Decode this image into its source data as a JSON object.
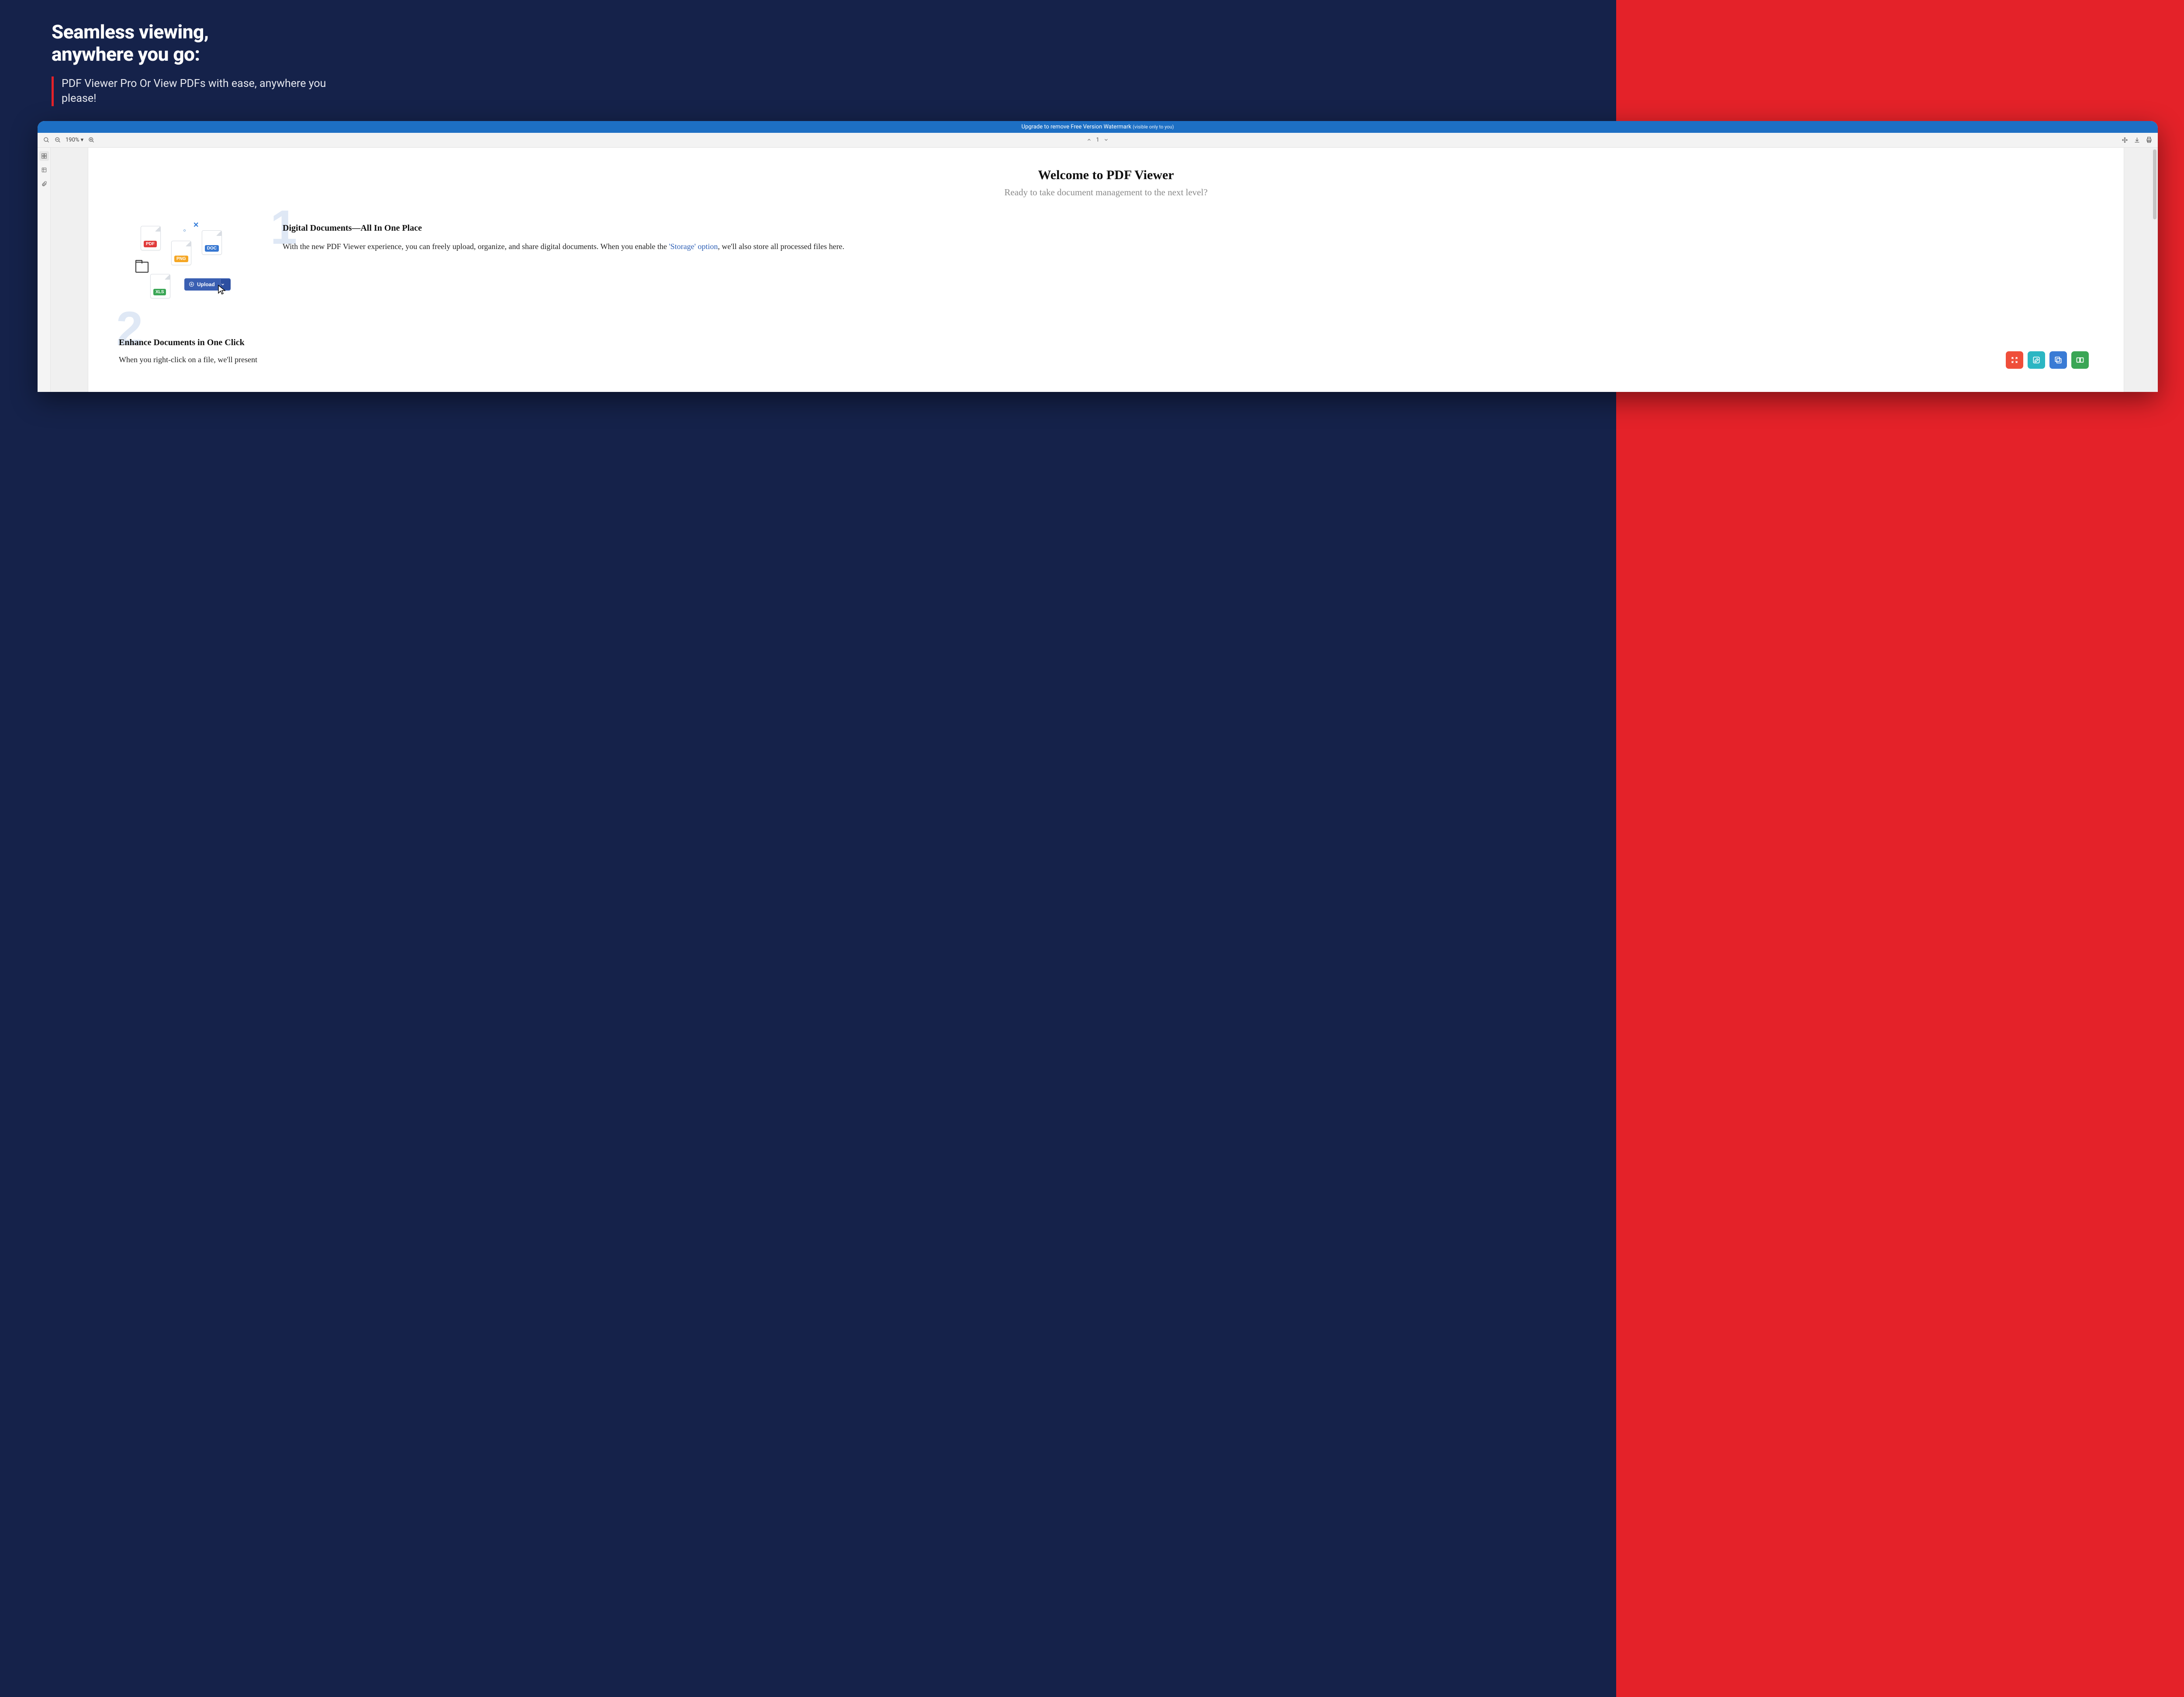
{
  "hero": {
    "title_l1": "Seamless viewing,",
    "title_l2": "anywhere you go:",
    "subtitle": "PDF Viewer Pro Or View PDFs with ease, anywhere you please!"
  },
  "banner": {
    "main": "Upgrade to remove Free Version Watermark ",
    "small": "(visible only to you)"
  },
  "toolbar": {
    "zoom": "190% ▾",
    "page": "1"
  },
  "document": {
    "title": "Welcome to PDF Viewer",
    "subtitle": "Ready to take document management to the next level?",
    "badges": {
      "pdf": "PDF",
      "png": "PNG",
      "doc": "DOC",
      "xls": "XLS"
    },
    "upload_label": "Upload",
    "section1": {
      "num": "1",
      "heading": "Digital Documents—All In One Place",
      "body_a": "With the new PDF Viewer experience, you can freely upload, organize, and share digital documents. When you enable the ",
      "link": "'Storage' option",
      "body_b": ", we'll also store all processed files here."
    },
    "section2": {
      "num": "2",
      "heading": "Enhance Documents in One Click",
      "body": "When you right-click on a file, we'll present"
    }
  },
  "colors": {
    "brand_blue": "#1d6fc4",
    "pdf": "#e03a3a",
    "png": "#f5a623",
    "doc": "#3777d1",
    "xls": "#3aa655",
    "upload": "#3a5fb2",
    "tile_red": "#ef4e3a",
    "tile_teal": "#2bb6c3",
    "tile_blue": "#3a7bd5",
    "tile_green": "#3aa655"
  }
}
